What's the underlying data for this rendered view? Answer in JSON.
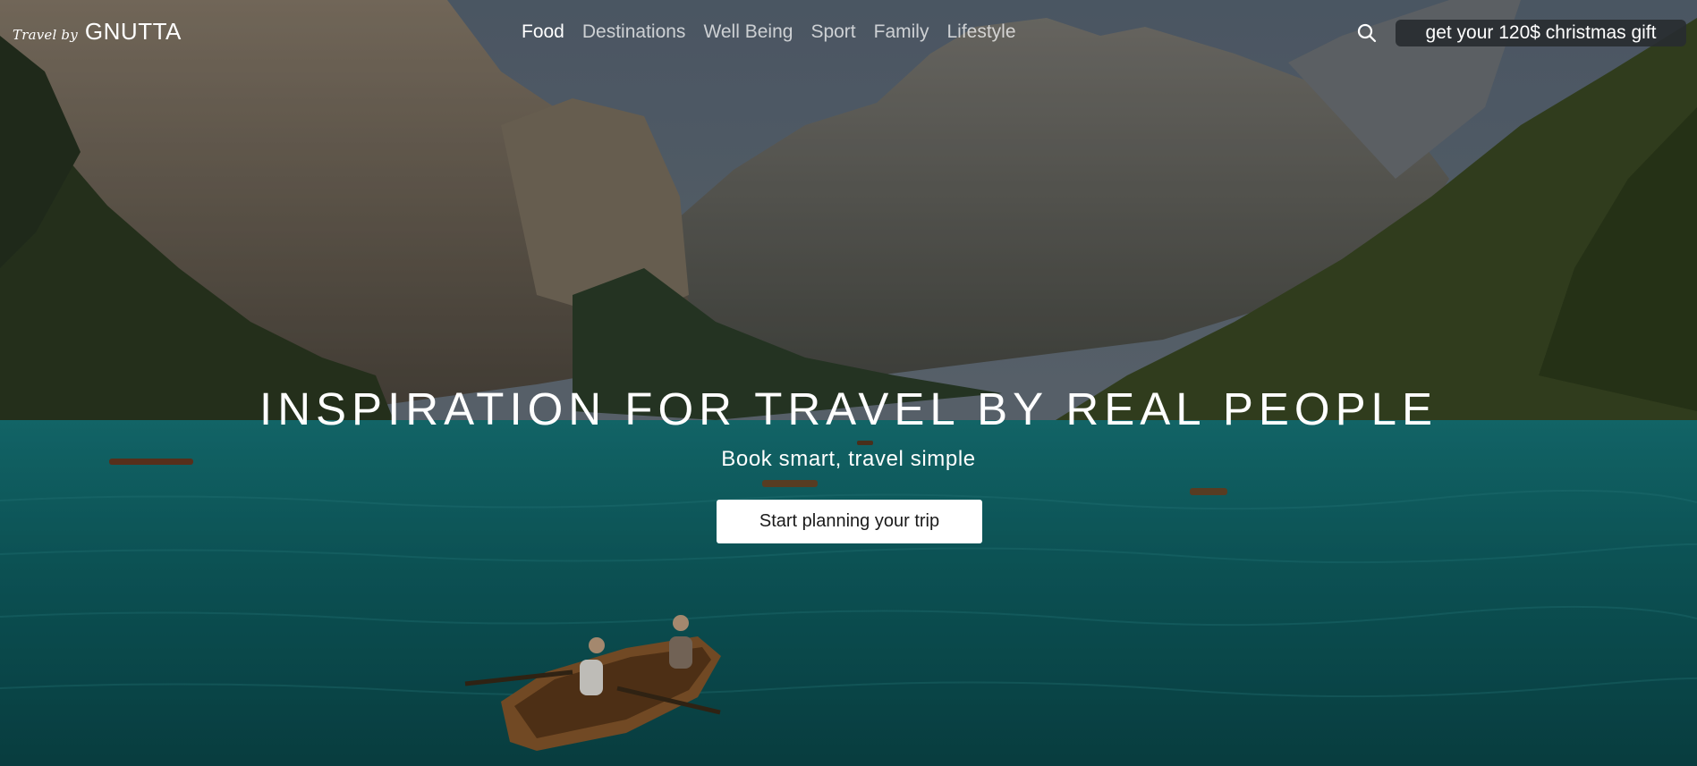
{
  "brand": {
    "script": "Travel by",
    "name": "GNUTTA"
  },
  "nav": {
    "items": [
      {
        "label": "Food",
        "active": true
      },
      {
        "label": "Destinations",
        "active": false
      },
      {
        "label": "Well Being",
        "active": false
      },
      {
        "label": "Sport",
        "active": false
      },
      {
        "label": "Family",
        "active": false
      },
      {
        "label": "Lifestyle",
        "active": false
      }
    ],
    "search_icon": "search-icon",
    "gift_label": "get your 120$ christmas gift"
  },
  "hero": {
    "title": "INSPIRATION FOR TRAVEL BY REAL PEOPLE",
    "subtitle": "Book smart, travel simple",
    "cta_label": "Start planning your trip",
    "background": "mountain-lake-with-rowboats"
  },
  "colors": {
    "water": "#0d5a5e",
    "gift_bg": "#282c30",
    "cta_bg": "#ffffff"
  }
}
